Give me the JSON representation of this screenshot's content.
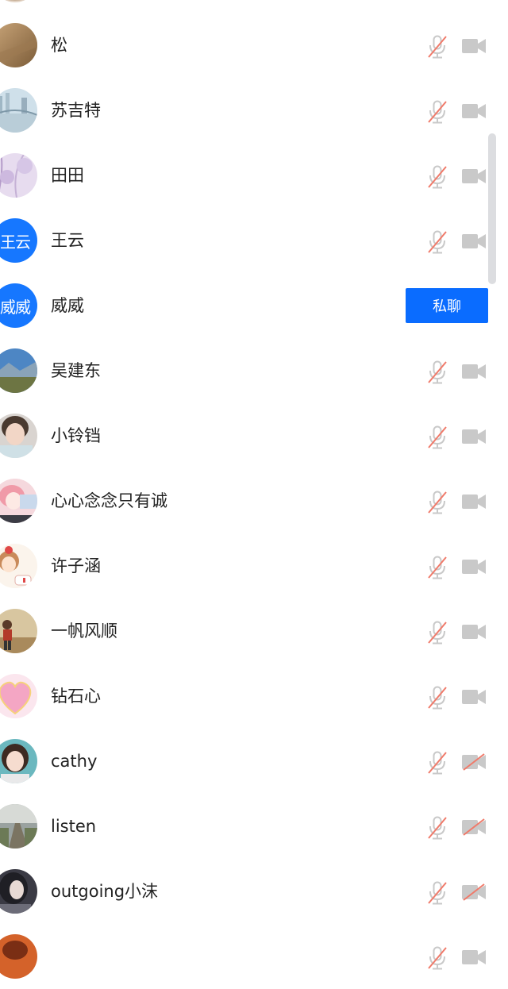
{
  "participants": [
    {
      "name": "",
      "avatar": "photo-tan",
      "mic": "muted",
      "camera": "off"
    },
    {
      "name": "松",
      "avatar": "photo-dry-grass",
      "mic": "muted",
      "camera": "off"
    },
    {
      "name": "苏吉特",
      "avatar": "photo-city-bridge",
      "mic": "muted",
      "camera": "off"
    },
    {
      "name": "田田",
      "avatar": "photo-lavender",
      "mic": "muted",
      "camera": "off"
    },
    {
      "name": "王云",
      "avatar_text": "王云",
      "mic": "muted",
      "camera": "off"
    },
    {
      "name": "威威",
      "avatar_text": "威威",
      "action_label": "私聊"
    },
    {
      "name": "吴建东",
      "avatar": "photo-mountain",
      "mic": "muted",
      "camera": "off"
    },
    {
      "name": "小铃铛",
      "avatar": "photo-girl",
      "mic": "muted",
      "camera": "off"
    },
    {
      "name": "心心念念只有诚",
      "avatar": "photo-anime-pink",
      "mic": "muted",
      "camera": "off"
    },
    {
      "name": "许子涵",
      "avatar": "photo-cartoon-girl",
      "mic": "muted",
      "camera": "off"
    },
    {
      "name": "一帆风顺",
      "avatar": "photo-figure",
      "mic": "muted",
      "camera": "off"
    },
    {
      "name": "钻石心",
      "avatar": "photo-pink-heart",
      "mic": "muted",
      "camera": "off"
    },
    {
      "name": "cathy",
      "avatar": "photo-woman",
      "mic": "muted",
      "camera": "disabled"
    },
    {
      "name": "listen",
      "avatar": "photo-path",
      "mic": "muted",
      "camera": "disabled"
    },
    {
      "name": "outgoing小沫",
      "avatar": "photo-dark-girl",
      "mic": "muted",
      "camera": "disabled"
    },
    {
      "name": "",
      "avatar": "photo-orange",
      "mic": "muted",
      "camera": "off"
    }
  ],
  "colors": {
    "accent": "#0a6cff",
    "avatar_text_bg": "#1677ff",
    "icon_gray": "#c9c9c9",
    "mute_slash": "#f07a6a"
  }
}
